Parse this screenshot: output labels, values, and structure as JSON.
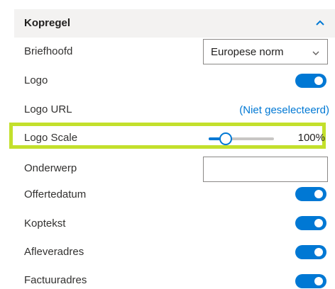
{
  "section": {
    "title": "Kopregel",
    "icon": "chevron-up-icon"
  },
  "rows": {
    "briefhoofd": {
      "label": "Briefhoofd",
      "value": "Europese norm"
    },
    "logo": {
      "label": "Logo",
      "on": true
    },
    "logo_url": {
      "label": "Logo URL",
      "value": "(Niet geselecteerd)"
    },
    "logo_scale": {
      "label": "Logo Scale",
      "value": "100%",
      "slider_fraction": 0.26
    },
    "onderwerp": {
      "label": "Onderwerp",
      "value": ""
    },
    "offertedatum": {
      "label": "Offertedatum",
      "on": true
    },
    "koptekst": {
      "label": "Koptekst",
      "on": true
    },
    "afleveradres": {
      "label": "Afleveradres",
      "on": true
    },
    "factuuradres": {
      "label": "Factuuradres",
      "on": true
    }
  },
  "colors": {
    "accent": "#0078d4",
    "highlight": "#c3e02c",
    "header_bg": "#f3f2f1"
  }
}
